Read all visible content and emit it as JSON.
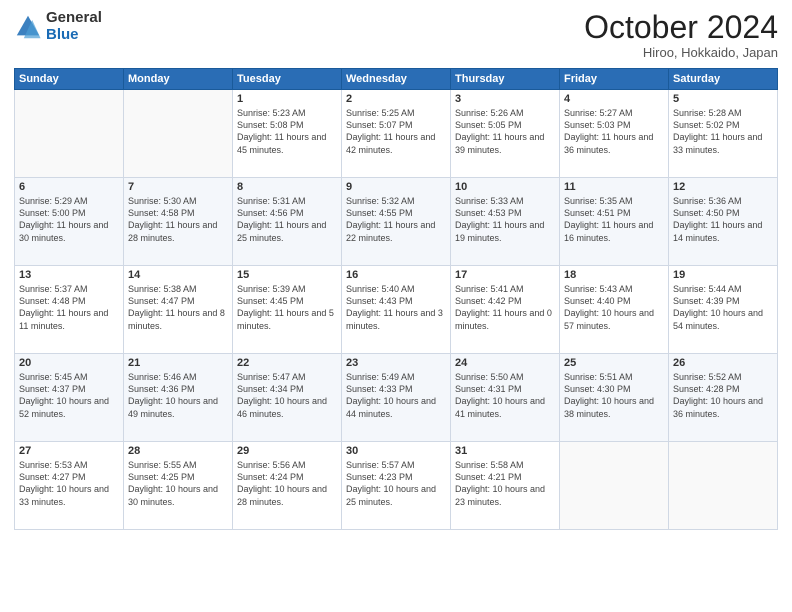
{
  "header": {
    "logo_general": "General",
    "logo_blue": "Blue",
    "month_title": "October 2024",
    "subtitle": "Hiroo, Hokkaido, Japan"
  },
  "weekdays": [
    "Sunday",
    "Monday",
    "Tuesday",
    "Wednesday",
    "Thursday",
    "Friday",
    "Saturday"
  ],
  "weeks": [
    [
      {
        "day": "",
        "sunrise": "",
        "sunset": "",
        "daylight": ""
      },
      {
        "day": "",
        "sunrise": "",
        "sunset": "",
        "daylight": ""
      },
      {
        "day": "1",
        "sunrise": "Sunrise: 5:23 AM",
        "sunset": "Sunset: 5:08 PM",
        "daylight": "Daylight: 11 hours and 45 minutes."
      },
      {
        "day": "2",
        "sunrise": "Sunrise: 5:25 AM",
        "sunset": "Sunset: 5:07 PM",
        "daylight": "Daylight: 11 hours and 42 minutes."
      },
      {
        "day": "3",
        "sunrise": "Sunrise: 5:26 AM",
        "sunset": "Sunset: 5:05 PM",
        "daylight": "Daylight: 11 hours and 39 minutes."
      },
      {
        "day": "4",
        "sunrise": "Sunrise: 5:27 AM",
        "sunset": "Sunset: 5:03 PM",
        "daylight": "Daylight: 11 hours and 36 minutes."
      },
      {
        "day": "5",
        "sunrise": "Sunrise: 5:28 AM",
        "sunset": "Sunset: 5:02 PM",
        "daylight": "Daylight: 11 hours and 33 minutes."
      }
    ],
    [
      {
        "day": "6",
        "sunrise": "Sunrise: 5:29 AM",
        "sunset": "Sunset: 5:00 PM",
        "daylight": "Daylight: 11 hours and 30 minutes."
      },
      {
        "day": "7",
        "sunrise": "Sunrise: 5:30 AM",
        "sunset": "Sunset: 4:58 PM",
        "daylight": "Daylight: 11 hours and 28 minutes."
      },
      {
        "day": "8",
        "sunrise": "Sunrise: 5:31 AM",
        "sunset": "Sunset: 4:56 PM",
        "daylight": "Daylight: 11 hours and 25 minutes."
      },
      {
        "day": "9",
        "sunrise": "Sunrise: 5:32 AM",
        "sunset": "Sunset: 4:55 PM",
        "daylight": "Daylight: 11 hours and 22 minutes."
      },
      {
        "day": "10",
        "sunrise": "Sunrise: 5:33 AM",
        "sunset": "Sunset: 4:53 PM",
        "daylight": "Daylight: 11 hours and 19 minutes."
      },
      {
        "day": "11",
        "sunrise": "Sunrise: 5:35 AM",
        "sunset": "Sunset: 4:51 PM",
        "daylight": "Daylight: 11 hours and 16 minutes."
      },
      {
        "day": "12",
        "sunrise": "Sunrise: 5:36 AM",
        "sunset": "Sunset: 4:50 PM",
        "daylight": "Daylight: 11 hours and 14 minutes."
      }
    ],
    [
      {
        "day": "13",
        "sunrise": "Sunrise: 5:37 AM",
        "sunset": "Sunset: 4:48 PM",
        "daylight": "Daylight: 11 hours and 11 minutes."
      },
      {
        "day": "14",
        "sunrise": "Sunrise: 5:38 AM",
        "sunset": "Sunset: 4:47 PM",
        "daylight": "Daylight: 11 hours and 8 minutes."
      },
      {
        "day": "15",
        "sunrise": "Sunrise: 5:39 AM",
        "sunset": "Sunset: 4:45 PM",
        "daylight": "Daylight: 11 hours and 5 minutes."
      },
      {
        "day": "16",
        "sunrise": "Sunrise: 5:40 AM",
        "sunset": "Sunset: 4:43 PM",
        "daylight": "Daylight: 11 hours and 3 minutes."
      },
      {
        "day": "17",
        "sunrise": "Sunrise: 5:41 AM",
        "sunset": "Sunset: 4:42 PM",
        "daylight": "Daylight: 11 hours and 0 minutes."
      },
      {
        "day": "18",
        "sunrise": "Sunrise: 5:43 AM",
        "sunset": "Sunset: 4:40 PM",
        "daylight": "Daylight: 10 hours and 57 minutes."
      },
      {
        "day": "19",
        "sunrise": "Sunrise: 5:44 AM",
        "sunset": "Sunset: 4:39 PM",
        "daylight": "Daylight: 10 hours and 54 minutes."
      }
    ],
    [
      {
        "day": "20",
        "sunrise": "Sunrise: 5:45 AM",
        "sunset": "Sunset: 4:37 PM",
        "daylight": "Daylight: 10 hours and 52 minutes."
      },
      {
        "day": "21",
        "sunrise": "Sunrise: 5:46 AM",
        "sunset": "Sunset: 4:36 PM",
        "daylight": "Daylight: 10 hours and 49 minutes."
      },
      {
        "day": "22",
        "sunrise": "Sunrise: 5:47 AM",
        "sunset": "Sunset: 4:34 PM",
        "daylight": "Daylight: 10 hours and 46 minutes."
      },
      {
        "day": "23",
        "sunrise": "Sunrise: 5:49 AM",
        "sunset": "Sunset: 4:33 PM",
        "daylight": "Daylight: 10 hours and 44 minutes."
      },
      {
        "day": "24",
        "sunrise": "Sunrise: 5:50 AM",
        "sunset": "Sunset: 4:31 PM",
        "daylight": "Daylight: 10 hours and 41 minutes."
      },
      {
        "day": "25",
        "sunrise": "Sunrise: 5:51 AM",
        "sunset": "Sunset: 4:30 PM",
        "daylight": "Daylight: 10 hours and 38 minutes."
      },
      {
        "day": "26",
        "sunrise": "Sunrise: 5:52 AM",
        "sunset": "Sunset: 4:28 PM",
        "daylight": "Daylight: 10 hours and 36 minutes."
      }
    ],
    [
      {
        "day": "27",
        "sunrise": "Sunrise: 5:53 AM",
        "sunset": "Sunset: 4:27 PM",
        "daylight": "Daylight: 10 hours and 33 minutes."
      },
      {
        "day": "28",
        "sunrise": "Sunrise: 5:55 AM",
        "sunset": "Sunset: 4:25 PM",
        "daylight": "Daylight: 10 hours and 30 minutes."
      },
      {
        "day": "29",
        "sunrise": "Sunrise: 5:56 AM",
        "sunset": "Sunset: 4:24 PM",
        "daylight": "Daylight: 10 hours and 28 minutes."
      },
      {
        "day": "30",
        "sunrise": "Sunrise: 5:57 AM",
        "sunset": "Sunset: 4:23 PM",
        "daylight": "Daylight: 10 hours and 25 minutes."
      },
      {
        "day": "31",
        "sunrise": "Sunrise: 5:58 AM",
        "sunset": "Sunset: 4:21 PM",
        "daylight": "Daylight: 10 hours and 23 minutes."
      },
      {
        "day": "",
        "sunrise": "",
        "sunset": "",
        "daylight": ""
      },
      {
        "day": "",
        "sunrise": "",
        "sunset": "",
        "daylight": ""
      }
    ]
  ]
}
